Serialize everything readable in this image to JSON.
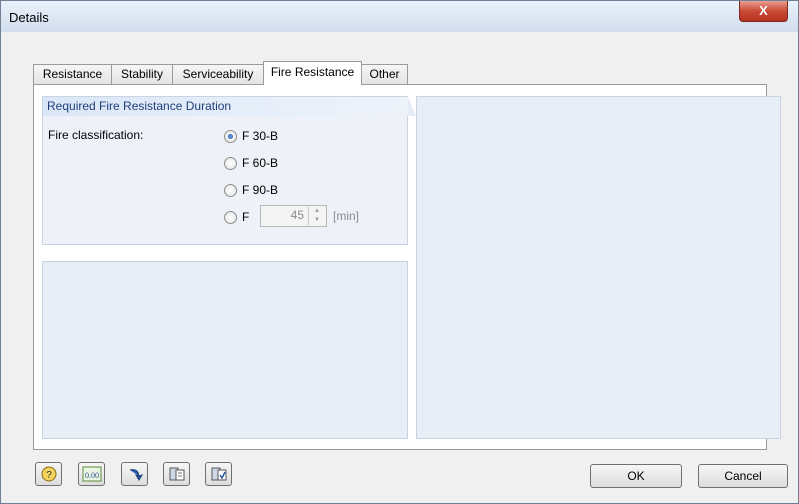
{
  "window": {
    "title": "Details",
    "close_label": "X"
  },
  "tabs": [
    {
      "label": "Resistance",
      "active": false
    },
    {
      "label": "Stability",
      "active": false
    },
    {
      "label": "Serviceability",
      "active": false
    },
    {
      "label": "Fire Resistance",
      "active": true
    },
    {
      "label": "Other",
      "active": false
    }
  ],
  "fire_group": {
    "title": "Required Fire Resistance Duration",
    "classification_label": "Fire classification:",
    "options": [
      {
        "label": "F 30-B",
        "checked": true
      },
      {
        "label": "F 60-B",
        "checked": false
      },
      {
        "label": "F 90-B",
        "checked": false
      },
      {
        "label": "F",
        "checked": false
      }
    ],
    "custom_value": "45",
    "custom_unit": "[min]"
  },
  "footer": {
    "icons": [
      "help-icon",
      "decimal-places-icon",
      "reset-defaults-icon",
      "load-defaults-icon",
      "save-defaults-icon"
    ],
    "ok_label": "OK",
    "cancel_label": "Cancel"
  }
}
